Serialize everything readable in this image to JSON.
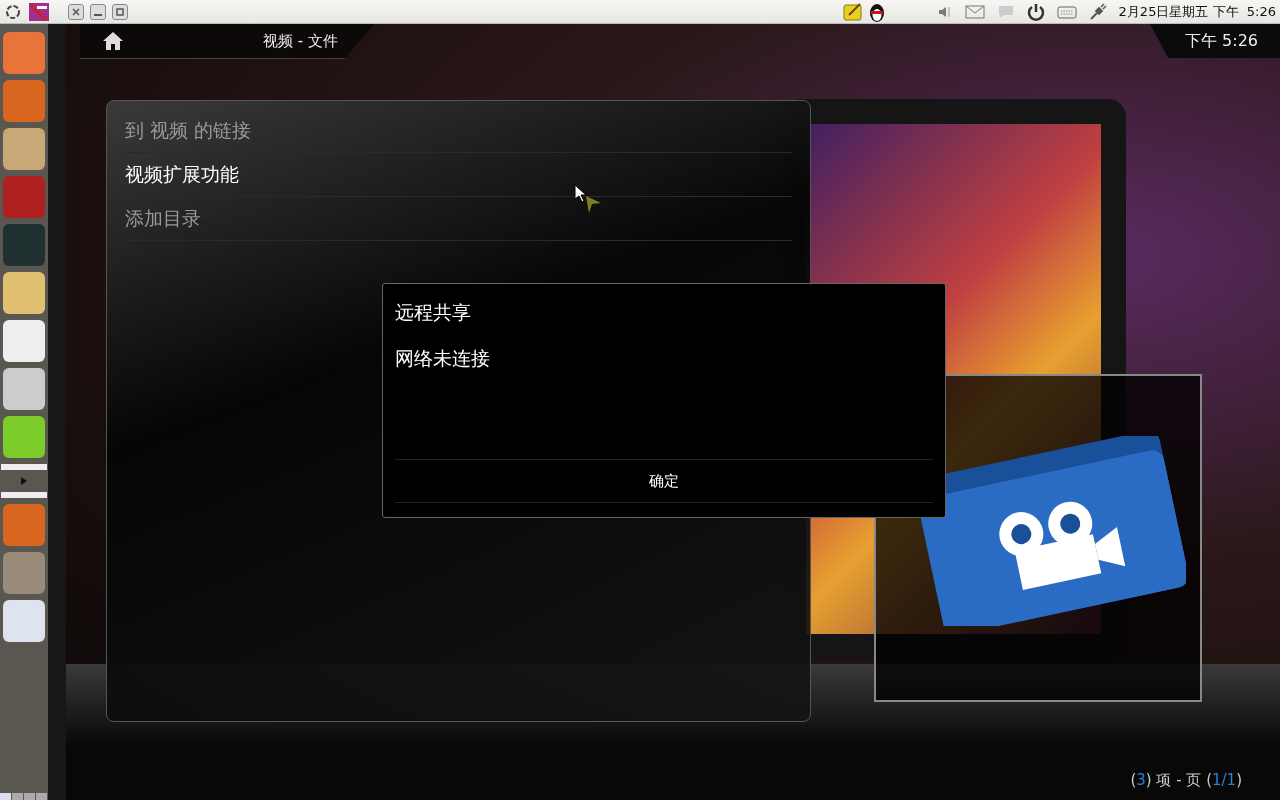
{
  "top_panel": {
    "clock": "2月25日星期五 下午  5:26"
  },
  "header": {
    "breadcrumb": "视频 - 文件",
    "time": "下午 5:26"
  },
  "menu": {
    "items": [
      {
        "label": "到 视频 的链接",
        "selected": false
      },
      {
        "label": "视频扩展功能",
        "selected": true
      },
      {
        "label": "添加目录",
        "selected": false
      }
    ]
  },
  "dialog": {
    "title": "远程共享",
    "message": "网络未连接",
    "button": "确定"
  },
  "footer": {
    "parts": [
      {
        "text": "(",
        "kind": "plain"
      },
      {
        "text": "3",
        "kind": "value"
      },
      {
        "text": ") 项 - 页 (",
        "kind": "plain"
      },
      {
        "text": "1/1",
        "kind": "value"
      },
      {
        "text": ")",
        "kind": "plain"
      }
    ]
  }
}
